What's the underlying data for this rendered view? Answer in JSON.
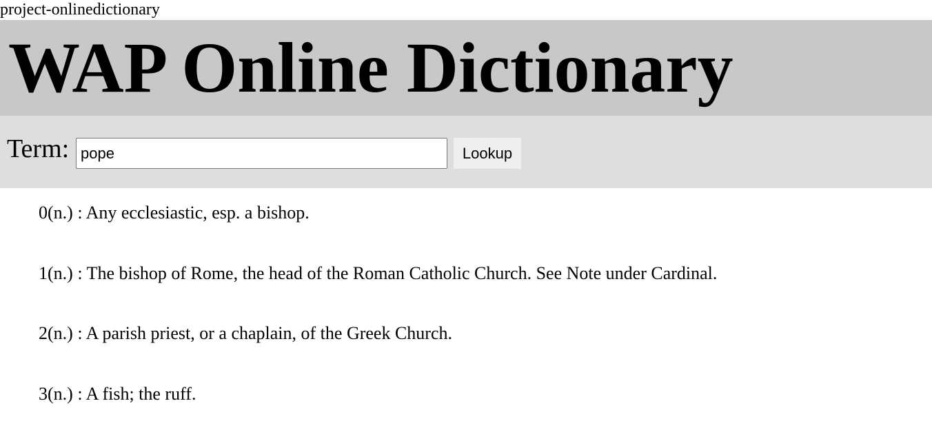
{
  "page": {
    "label": "project-onlinedictionary"
  },
  "header": {
    "title": "WAP Online Dictionary"
  },
  "search": {
    "term_label": "Term:",
    "value": "pope",
    "lookup_label": "Lookup"
  },
  "results": [
    "0(n.) : Any ecclesiastic, esp. a bishop.",
    "1(n.) : The bishop of Rome, the head of the Roman Catholic Church. See Note under Cardinal.",
    "2(n.) : A parish priest, or a chaplain, of the Greek Church.",
    "3(n.) : A fish; the ruff."
  ],
  "colors": {
    "header_bg": "#c8c8c8",
    "search_bar_bg": "#dfdedd",
    "button_bg": "#efefef"
  }
}
